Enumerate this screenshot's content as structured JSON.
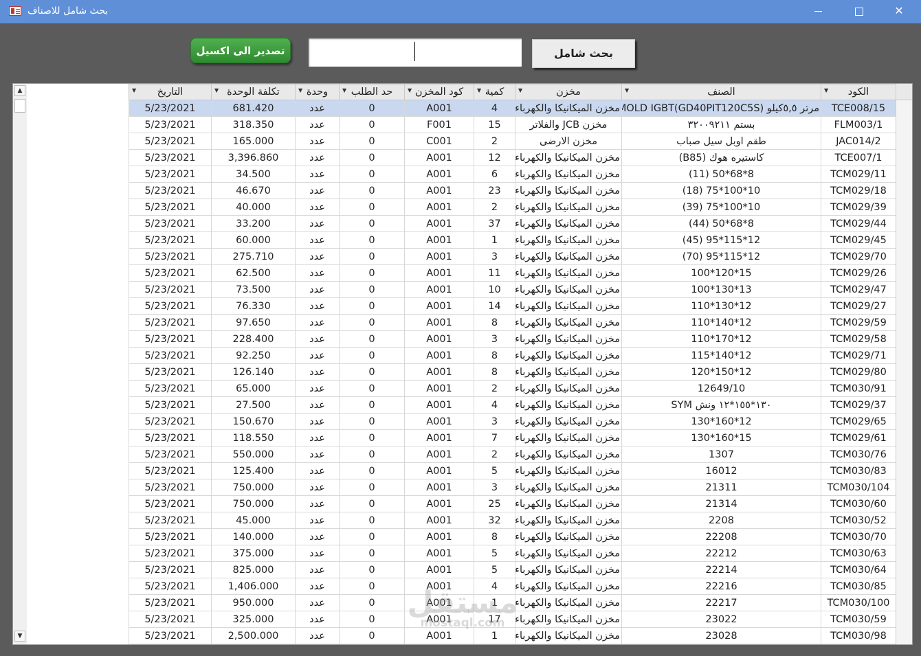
{
  "window": {
    "title": "بحث شامل للاصناف",
    "icon": "access-form-icon"
  },
  "toolbar": {
    "export_label": "تصدير الى اكسيل",
    "search_value": "",
    "search_label": "بحث شامل"
  },
  "grid": {
    "columns": [
      "التاريخ",
      "تكلفة الوحدة",
      "وحدة",
      "حد الطلب",
      "كود المخزن",
      "كمية",
      "مخزن",
      "الصنف",
      "الكود"
    ],
    "rows": [
      [
        "5/23/2021",
        "681.420",
        "عدد",
        "0",
        "A001",
        "4",
        "مخزن الميكانيكا والكهرباء",
        "مرتر ٥,٥كيلو (MOLD IGBT(GD40PIT120C5S",
        "TCE008/15"
      ],
      [
        "5/23/2021",
        "318.350",
        "عدد",
        "0",
        "F001",
        "15",
        "مخزن JCB  والفلاتر",
        "بستم ٣٢٠٠٩٢١١",
        "FLM003/1"
      ],
      [
        "5/23/2021",
        "165.000",
        "عدد",
        "0",
        "C001",
        "2",
        "مخزن الارضى",
        "طقم اوبل سيل صباب",
        "JAC014/2"
      ],
      [
        "5/23/2021",
        "3,396.860",
        "عدد",
        "0",
        "A001",
        "12",
        "مخزن الميكانيكا والكهرباء",
        "كاستيره هوك (B85)",
        "TCE007/1"
      ],
      [
        "5/23/2021",
        "34.500",
        "عدد",
        "0",
        "A001",
        "6",
        "مخزن الميكانيكا والكهرباء",
        "8*68*50 (11)",
        "TCM029/11"
      ],
      [
        "5/23/2021",
        "46.670",
        "عدد",
        "0",
        "A001",
        "23",
        "مخزن الميكانيكا والكهرباء",
        "10*100*75 (18)",
        "TCM029/18"
      ],
      [
        "5/23/2021",
        "40.000",
        "عدد",
        "0",
        "A001",
        "2",
        "مخزن الميكانيكا والكهرباء",
        "10*100*75 (39)",
        "TCM029/39"
      ],
      [
        "5/23/2021",
        "33.200",
        "عدد",
        "0",
        "A001",
        "37",
        "مخزن الميكانيكا والكهرباء",
        "8*68*50 (44)",
        "TCM029/44"
      ],
      [
        "5/23/2021",
        "60.000",
        "عدد",
        "0",
        "A001",
        "1",
        "مخزن الميكانيكا والكهرباء",
        "12*115*95 (45)",
        "TCM029/45"
      ],
      [
        "5/23/2021",
        "275.710",
        "عدد",
        "0",
        "A001",
        "3",
        "مخزن الميكانيكا والكهرباء",
        "12*115*95 (70)",
        "TCM029/70"
      ],
      [
        "5/23/2021",
        "62.500",
        "عدد",
        "0",
        "A001",
        "11",
        "مخزن الميكانيكا والكهرباء",
        "15*120*100",
        "TCM029/26"
      ],
      [
        "5/23/2021",
        "73.500",
        "عدد",
        "0",
        "A001",
        "10",
        "مخزن الميكانيكا والكهرباء",
        "13*130*100",
        "TCM029/47"
      ],
      [
        "5/23/2021",
        "76.330",
        "عدد",
        "0",
        "A001",
        "14",
        "مخزن الميكانيكا والكهرباء",
        "12*130*110",
        "TCM029/27"
      ],
      [
        "5/23/2021",
        "97.650",
        "عدد",
        "0",
        "A001",
        "8",
        "مخزن الميكانيكا والكهرباء",
        "12*140*110",
        "TCM029/59"
      ],
      [
        "5/23/2021",
        "228.400",
        "عدد",
        "0",
        "A001",
        "3",
        "مخزن الميكانيكا والكهرباء",
        "12*170*110",
        "TCM029/58"
      ],
      [
        "5/23/2021",
        "92.250",
        "عدد",
        "0",
        "A001",
        "8",
        "مخزن الميكانيكا والكهرباء",
        "12*140*115",
        "TCM029/71"
      ],
      [
        "5/23/2021",
        "126.140",
        "عدد",
        "0",
        "A001",
        "8",
        "مخزن الميكانيكا والكهرباء",
        "12*150*120",
        "TCM029/80"
      ],
      [
        "5/23/2021",
        "65.000",
        "عدد",
        "0",
        "A001",
        "2",
        "مخزن الميكانيكا والكهرباء",
        "12649/10",
        "TCM030/91"
      ],
      [
        "5/23/2021",
        "27.500",
        "عدد",
        "0",
        "A001",
        "4",
        "مخزن الميكانيكا والكهرباء",
        "١٣٠*١٥٥*١٢ ونش  SYM",
        "TCM029/37"
      ],
      [
        "5/23/2021",
        "150.670",
        "عدد",
        "0",
        "A001",
        "3",
        "مخزن الميكانيكا والكهرباء",
        "12*160*130",
        "TCM029/65"
      ],
      [
        "5/23/2021",
        "118.550",
        "عدد",
        "0",
        "A001",
        "7",
        "مخزن الميكانيكا والكهرباء",
        "15*160*130",
        "TCM029/61"
      ],
      [
        "5/23/2021",
        "550.000",
        "عدد",
        "0",
        "A001",
        "2",
        "مخزن الميكانيكا والكهرباء",
        "1307",
        "TCM030/76"
      ],
      [
        "5/23/2021",
        "125.400",
        "عدد",
        "0",
        "A001",
        "5",
        "مخزن الميكانيكا والكهرباء",
        "16012",
        "TCM030/83"
      ],
      [
        "5/23/2021",
        "750.000",
        "عدد",
        "0",
        "A001",
        "3",
        "مخزن الميكانيكا والكهرباء",
        "21311",
        "TCM030/104"
      ],
      [
        "5/23/2021",
        "750.000",
        "عدد",
        "0",
        "A001",
        "25",
        "مخزن الميكانيكا والكهرباء",
        "21314",
        "TCM030/60"
      ],
      [
        "5/23/2021",
        "45.000",
        "عدد",
        "0",
        "A001",
        "32",
        "مخزن الميكانيكا والكهرباء",
        "2208",
        "TCM030/52"
      ],
      [
        "5/23/2021",
        "140.000",
        "عدد",
        "0",
        "A001",
        "8",
        "مخزن الميكانيكا والكهرباء",
        "22208",
        "TCM030/70"
      ],
      [
        "5/23/2021",
        "375.000",
        "عدد",
        "0",
        "A001",
        "5",
        "مخزن الميكانيكا والكهرباء",
        "22212",
        "TCM030/63"
      ],
      [
        "5/23/2021",
        "825.000",
        "عدد",
        "0",
        "A001",
        "5",
        "مخزن الميكانيكا والكهرباء",
        "22214",
        "TCM030/64"
      ],
      [
        "5/23/2021",
        "1,406.000",
        "عدد",
        "0",
        "A001",
        "4",
        "مخزن الميكانيكا والكهرباء",
        "22216",
        "TCM030/85"
      ],
      [
        "5/23/2021",
        "950.000",
        "عدد",
        "0",
        "A001",
        "1",
        "مخزن الميكانيكا والكهرباء",
        "22217",
        "TCM030/100"
      ],
      [
        "5/23/2021",
        "325.000",
        "عدد",
        "0",
        "A001",
        "17",
        "مخزن الميكانيكا والكهرباء",
        "23022",
        "TCM030/59"
      ],
      [
        "5/23/2021",
        "2,500.000",
        "عدد",
        "0",
        "A001",
        "1",
        "مخزن الميكانيكا والكهرباء",
        "23028",
        "TCM030/98"
      ]
    ]
  },
  "watermark": {
    "text": "مستقل",
    "sub": "mostaql.com"
  }
}
